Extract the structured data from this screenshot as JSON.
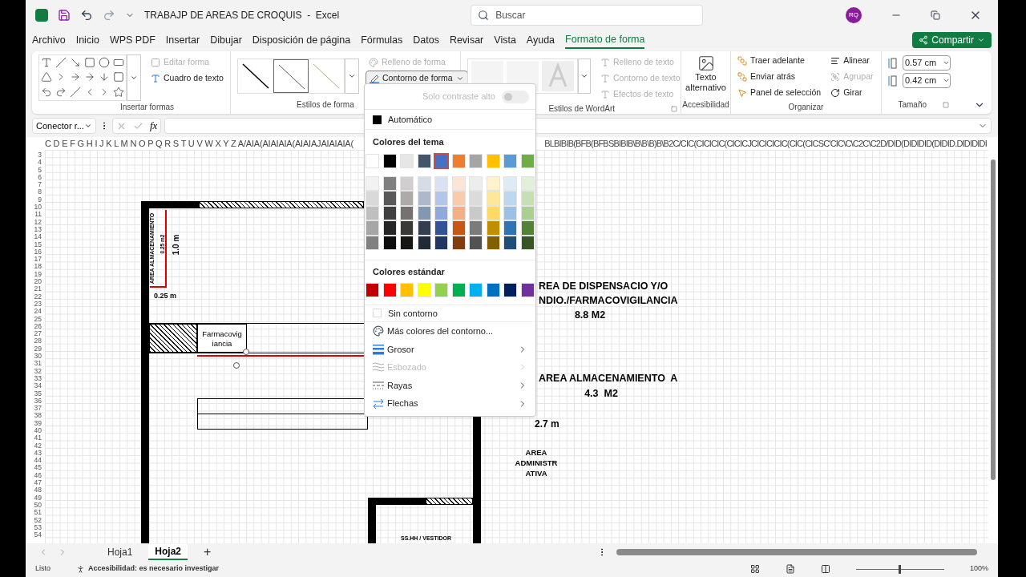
{
  "window": {
    "title": "TRABAJP DE AREAS DE CROQUIS  -  Excel",
    "search_placeholder": "Buscar",
    "avatar": "RQ"
  },
  "ribbon_tabs": [
    {
      "label": "Archivo",
      "selected": false
    },
    {
      "label": "Inicio",
      "selected": false
    },
    {
      "label": "WPS PDF",
      "selected": false
    },
    {
      "label": "Insertar",
      "selected": false
    },
    {
      "label": "Dibujar",
      "selected": false
    },
    {
      "label": "Disposición de página",
      "selected": false
    },
    {
      "label": "Fórmulas",
      "selected": false
    },
    {
      "label": "Datos",
      "selected": false
    },
    {
      "label": "Revisar",
      "selected": false
    },
    {
      "label": "Vista",
      "selected": false
    },
    {
      "label": "Ayuda",
      "selected": false
    },
    {
      "label": "Formato de forma",
      "selected": true
    }
  ],
  "share_button": "Compartir",
  "ribbon": {
    "insert_shapes": {
      "edit_shape": {
        "label": "Editar forma",
        "disabled": true
      },
      "text_box": {
        "label": "Cuadro de texto",
        "disabled": false
      },
      "group_label": "Insertar formas"
    },
    "shape_styles": {
      "shape_fill": {
        "label": "Relleno de forma",
        "disabled": true
      },
      "shape_outline": {
        "label": "Contorno de forma",
        "pressed": true
      },
      "group_label": "Estilos de forma"
    },
    "wordart": {
      "items": [
        {
          "label": "Relleno de texto",
          "disabled": true
        },
        {
          "label": "Contorno de texto",
          "disabled": true
        },
        {
          "label": "Efectos de texto",
          "disabled": true
        }
      ],
      "group_label": "Estilos de WordArt"
    },
    "accessibility": {
      "alt_text": "Texto alternativo",
      "group_label": "Accesibilidad"
    },
    "arrange": {
      "items": [
        {
          "label": "Traer adelante",
          "disabled": false
        },
        {
          "label": "Enviar atrás",
          "disabled": false
        },
        {
          "label": "Panel de selección",
          "disabled": false
        }
      ],
      "align": [
        {
          "label": "Alinear",
          "disabled": false
        },
        {
          "label": "Agrupar",
          "disabled": true
        },
        {
          "label": "Girar",
          "disabled": false
        }
      ],
      "group_label": "Organizar"
    },
    "size": {
      "height": "0.57 cm",
      "width": "0.42 cm",
      "group_label": "Tamaño"
    }
  },
  "formula_bar": {
    "name_box": "Conector r...",
    "fx": "fx"
  },
  "column_headers": [
    "C D E F G H I J K L M N O P Q R S T U V W X Y Z A/AIA(AIAIAIA(AIAIAJAIAIAIA(",
    "BLBIBIB(BFB(BFBSBIBIB\\B\\B\\B)B\\B2C/CIC(CICICIC(CICICJCICICICIC(CIC(CICSC'CIC\\C\\C2C\\C2D/DID(DIDIDID(DIDID.DIDIDIDI"
  ],
  "row_headers": [
    "3",
    "4",
    "5",
    "6",
    "7",
    "8",
    "9",
    "10",
    "11",
    "12",
    "13",
    "14",
    "15",
    "16",
    "17",
    "18",
    "19",
    "20",
    "21",
    "22",
    "23",
    "24",
    "25",
    "26",
    "27",
    "28",
    "29",
    "30",
    "31",
    "32",
    "33",
    "34",
    "35",
    "36",
    "37",
    "38",
    "39",
    "40",
    "41",
    "42",
    "43",
    "44",
    "45",
    "46",
    "47",
    "48",
    "49",
    "50",
    "51",
    "52",
    "53",
    "54"
  ],
  "plan": {
    "storage_small": "AREA ALMACENAMIENTO",
    "storage_small_area": "0.25 m2",
    "height_dim": "1.0 m",
    "width_dim": "0.25 m",
    "pharma_box": "Farmacovig iancia",
    "dispensing": [
      "REA DE DISPENSACIO Y/O",
      "NDIO./FARMACOVIGILANCIA",
      "8.8 M2"
    ],
    "storage": [
      "AREA ALMACENAMIENTO  A",
      "4.3  M2"
    ],
    "dim_27": "2.7 m",
    "admin": [
      "AREA",
      "ADMINISTR",
      "ATIVA"
    ],
    "restroom": "SS.HH / VESTIDOR"
  },
  "outline_menu": {
    "high_contrast": {
      "label": "Solo contraste alto",
      "on": false
    },
    "automatic": "Automático",
    "theme_title": "Colores del tema",
    "theme_colors": [
      {
        "color": "#ffffff",
        "selected": false,
        "shades": [
          {
            "color": "#f2f2f2",
            "selected": false
          },
          {
            "color": "#d9d9d9",
            "selected": false
          },
          {
            "color": "#bfbfbf",
            "selected": false
          },
          {
            "color": "#a6a6a6",
            "selected": false
          },
          {
            "color": "#808080",
            "selected": false
          }
        ]
      },
      {
        "color": "#000000",
        "selected": false,
        "shades": [
          {
            "color": "#7f7f7f",
            "selected": false
          },
          {
            "color": "#595959",
            "selected": false
          },
          {
            "color": "#404040",
            "selected": false
          },
          {
            "color": "#262626",
            "selected": false
          },
          {
            "color": "#0d0d0d",
            "selected": false
          }
        ]
      },
      {
        "color": "#e7e6e6",
        "selected": false,
        "shades": [
          {
            "color": "#d0cece",
            "selected": false
          },
          {
            "color": "#aeaaaa",
            "selected": false
          },
          {
            "color": "#767171",
            "selected": false
          },
          {
            "color": "#3b3838",
            "selected": false
          },
          {
            "color": "#171616",
            "selected": false
          }
        ]
      },
      {
        "color": "#44546a",
        "selected": false,
        "shades": [
          {
            "color": "#d6dce4",
            "selected": false
          },
          {
            "color": "#adb9ca",
            "selected": false
          },
          {
            "color": "#8497b0",
            "selected": false
          },
          {
            "color": "#333f4f",
            "selected": false
          },
          {
            "color": "#222a35",
            "selected": false
          }
        ]
      },
      {
        "color": "#4472c4",
        "selected": true,
        "shades": [
          {
            "color": "#d9e1f2",
            "selected": false
          },
          {
            "color": "#b4c6e7",
            "selected": false
          },
          {
            "color": "#8ea9db",
            "selected": false
          },
          {
            "color": "#305496",
            "selected": false
          },
          {
            "color": "#203764",
            "selected": false
          }
        ]
      },
      {
        "color": "#ed7d31",
        "selected": false,
        "shades": [
          {
            "color": "#fce4d6",
            "selected": false
          },
          {
            "color": "#f8cbad",
            "selected": false
          },
          {
            "color": "#f4b084",
            "selected": false
          },
          {
            "color": "#c65911",
            "selected": false
          },
          {
            "color": "#833c0c",
            "selected": false
          }
        ]
      },
      {
        "color": "#a5a5a5",
        "selected": false,
        "shades": [
          {
            "color": "#ededed",
            "selected": false
          },
          {
            "color": "#dbdbdb",
            "selected": false
          },
          {
            "color": "#c9c9c9",
            "selected": false
          },
          {
            "color": "#7b7b7b",
            "selected": false
          },
          {
            "color": "#525252",
            "selected": false
          }
        ]
      },
      {
        "color": "#ffc000",
        "selected": false,
        "shades": [
          {
            "color": "#fff2cc",
            "selected": false
          },
          {
            "color": "#ffe699",
            "selected": false
          },
          {
            "color": "#ffd966",
            "selected": false
          },
          {
            "color": "#bf8f00",
            "selected": false
          },
          {
            "color": "#806000",
            "selected": false
          }
        ]
      },
      {
        "color": "#5b9bd5",
        "selected": false,
        "shades": [
          {
            "color": "#ddebf7",
            "selected": false
          },
          {
            "color": "#bdd7ee",
            "selected": false
          },
          {
            "color": "#9bc2e6",
            "selected": false
          },
          {
            "color": "#2f75b5",
            "selected": false
          },
          {
            "color": "#1f4e78",
            "selected": false
          }
        ]
      },
      {
        "color": "#70ad47",
        "selected": false,
        "shades": [
          {
            "color": "#e2efda",
            "selected": false
          },
          {
            "color": "#c6e0b4",
            "selected": false
          },
          {
            "color": "#a9d08e",
            "selected": false
          },
          {
            "color": "#548235",
            "selected": false
          },
          {
            "color": "#375623",
            "selected": false
          }
        ]
      }
    ],
    "standard_title": "Colores estándar",
    "standard_colors": [
      {
        "color": "#c00000",
        "selected": false
      },
      {
        "color": "#ff0000",
        "selected": false
      },
      {
        "color": "#ffc000",
        "selected": false
      },
      {
        "color": "#ffff00",
        "selected": false
      },
      {
        "color": "#92d050",
        "selected": false
      },
      {
        "color": "#00b050",
        "selected": false
      },
      {
        "color": "#00b0f0",
        "selected": false
      },
      {
        "color": "#0070c0",
        "selected": false
      },
      {
        "color": "#002060",
        "selected": false
      },
      {
        "color": "#7030a0",
        "selected": false
      }
    ],
    "no_outline": "Sin contorno",
    "items": [
      {
        "kind": "palette",
        "label": "Más colores del contorno...",
        "submenu": false,
        "disabled": false
      },
      {
        "kind": "weight",
        "label": "Grosor",
        "submenu": true,
        "disabled": false
      },
      {
        "kind": "sketch",
        "label": "Esbozado",
        "submenu": true,
        "disabled": true
      },
      {
        "kind": "dashes",
        "label": "Rayas",
        "submenu": true,
        "disabled": false
      },
      {
        "kind": "arrows",
        "label": "Flechas",
        "submenu": true,
        "disabled": false
      }
    ]
  },
  "sheet_tabs": [
    {
      "label": "Hoja1",
      "selected": false
    },
    {
      "label": "Hoja2",
      "selected": true
    }
  ],
  "add_sheet": "+",
  "status_bar": {
    "ready": "Listo",
    "accessibility": "Accesibilidad: es necesario investigar",
    "zoom": "100%",
    "zoom_slider": {
      "level": 0.5
    }
  }
}
